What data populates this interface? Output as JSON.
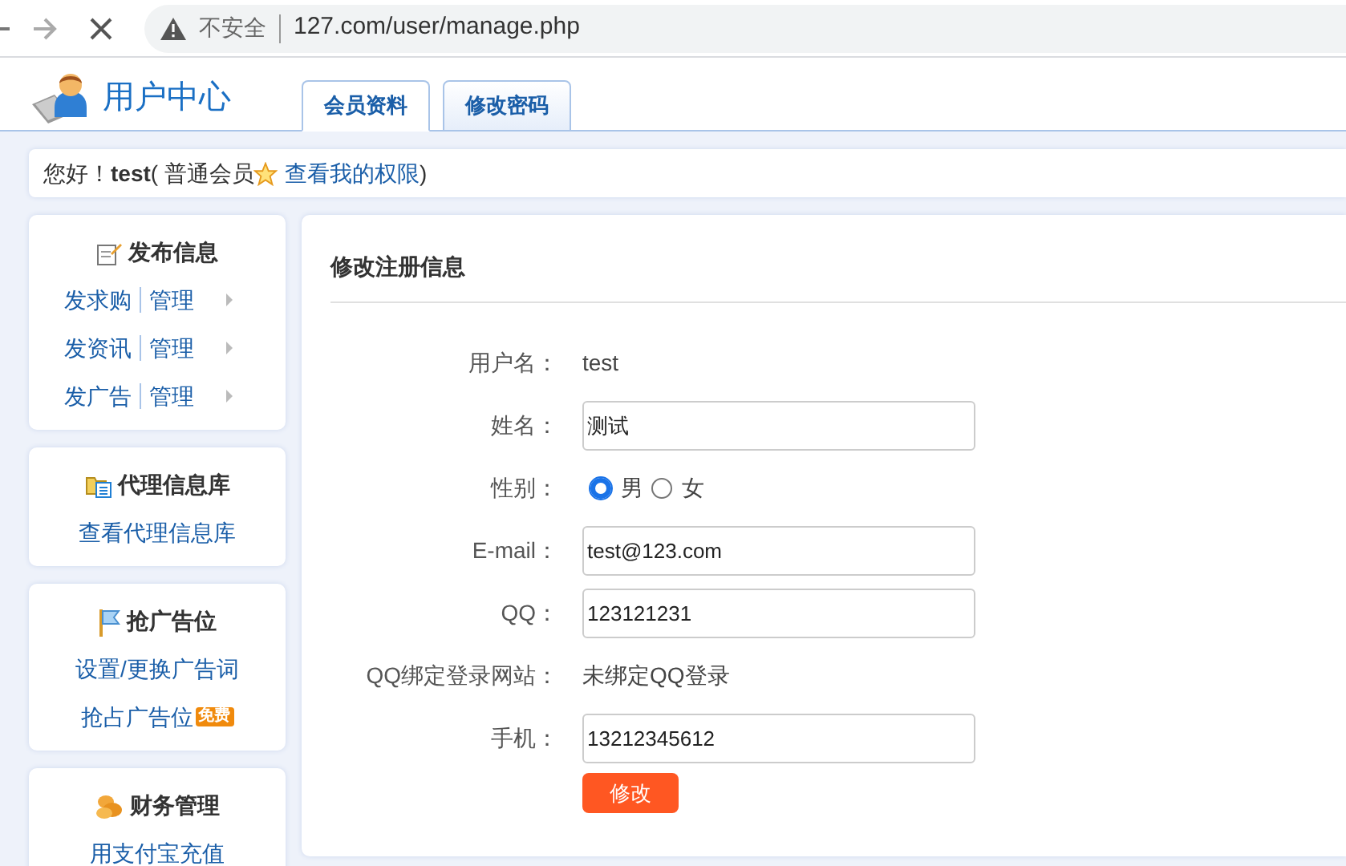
{
  "browser": {
    "security": "不安全",
    "url": "127.com/user/manage.php"
  },
  "header": {
    "title": "用户中心",
    "tabs": [
      {
        "label": "会员资料",
        "selected": true
      },
      {
        "label": "修改密码",
        "selected": false
      }
    ]
  },
  "greeting": {
    "text": "您好！**test**( 普通会员",
    "link": "查看我的权限",
    "close": ")"
  },
  "sidebar": [
    {
      "title": "发布信息",
      "items": [
        {
          "kind": "pair",
          "label": "发求购",
          "manage": "管理"
        },
        {
          "kind": "pair",
          "label": "发资讯",
          "manage": "管理"
        },
        {
          "kind": "pair",
          "label": "发广告",
          "manage": "管理"
        }
      ]
    },
    {
      "title": "代理信息库",
      "items": [
        {
          "kind": "link",
          "label": "查看代理信息库"
        }
      ]
    },
    {
      "title": "抢广告位",
      "items": [
        {
          "kind": "link",
          "label": "设置/更换广告词"
        },
        {
          "kind": "link",
          "label": "抢占广告位",
          "badge": "免费"
        }
      ]
    },
    {
      "title": "财务管理",
      "items": [
        {
          "kind": "link",
          "label": "用支付宝充值"
        }
      ]
    }
  ],
  "form": {
    "title": "修改注册信息",
    "fields": [
      {
        "kind": "static",
        "label": "用户名：",
        "value": "test"
      },
      {
        "kind": "input",
        "label": "姓名：",
        "value": "测试"
      },
      {
        "kind": "radio",
        "label": "性别：",
        "options": [
          {
            "label": "男",
            "selected": true
          },
          {
            "label": "女",
            "selected": false
          }
        ]
      },
      {
        "kind": "input",
        "label": "E-mail：",
        "value": "test@123.com"
      },
      {
        "kind": "input",
        "label": "QQ：",
        "value": "123121231"
      },
      {
        "kind": "static",
        "label": "QQ绑定登录网站：",
        "value": "未绑定QQ登录"
      },
      {
        "kind": "input",
        "label": "手机：",
        "value": "13212345612"
      }
    ],
    "submit": "修改"
  }
}
